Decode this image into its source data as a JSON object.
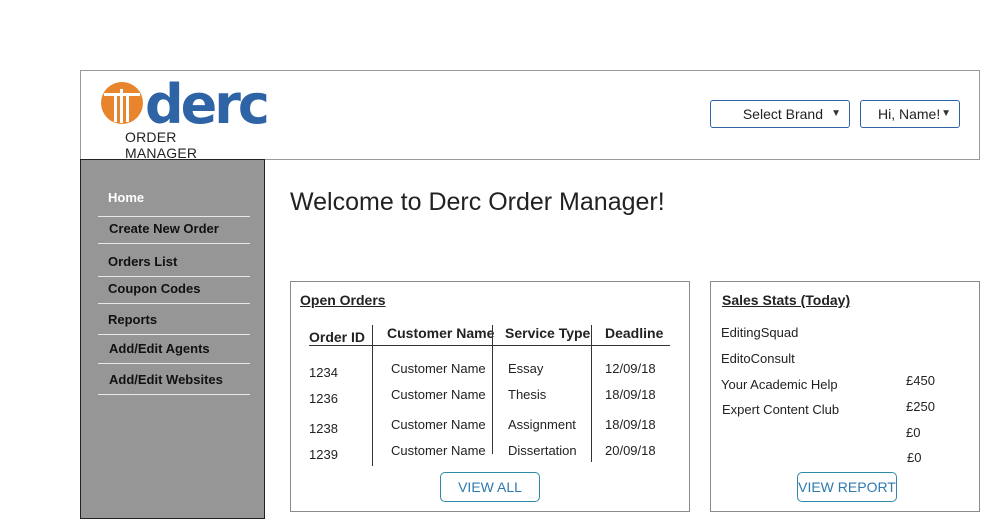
{
  "brand": {
    "logo_text": "derc",
    "subtitle": "ORDER MANAGER",
    "colors": {
      "orange": "#e8842c",
      "blue": "#2e63a6"
    }
  },
  "header": {
    "brand_select": {
      "label": "Select Brand",
      "icon": "chevron-down-icon"
    },
    "user_menu": {
      "label": "Hi, Name!",
      "icon": "chevron-down-icon"
    }
  },
  "sidebar": {
    "items": [
      {
        "label": "Home",
        "active": true
      },
      {
        "label": "Create New Order"
      },
      {
        "label": "Orders List"
      },
      {
        "label": "Coupon Codes"
      },
      {
        "label": "Reports"
      },
      {
        "label": "Add/Edit Agents"
      },
      {
        "label": "Add/Edit Websites"
      }
    ]
  },
  "main": {
    "welcome": "Welcome to Derc Order Manager!"
  },
  "open_orders": {
    "title": "Open Orders",
    "columns": [
      "Order ID",
      "Customer Name",
      "Service Type",
      "Deadline"
    ],
    "rows": [
      {
        "id": "1234",
        "customer": "Customer Name",
        "service": "Essay",
        "deadline": "12/09/18"
      },
      {
        "id": "1236",
        "customer": "Customer Name",
        "service": "Thesis",
        "deadline": "18/09/18"
      },
      {
        "id": "1238",
        "customer": "Customer Name",
        "service": "Assignment",
        "deadline": "18/09/18"
      },
      {
        "id": "1239",
        "customer": "Customer Name",
        "service": "Dissertation",
        "deadline": "20/09/18"
      }
    ],
    "button": "VIEW ALL"
  },
  "sales_stats": {
    "title": "Sales Stats (Today)",
    "sites": [
      "EditingSquad",
      "EditoConsult",
      "Your Academic Help",
      "Expert Content Club"
    ],
    "amounts": [
      "£450",
      "£250",
      "£0",
      "£0"
    ],
    "button": "VIEW REPORT"
  }
}
